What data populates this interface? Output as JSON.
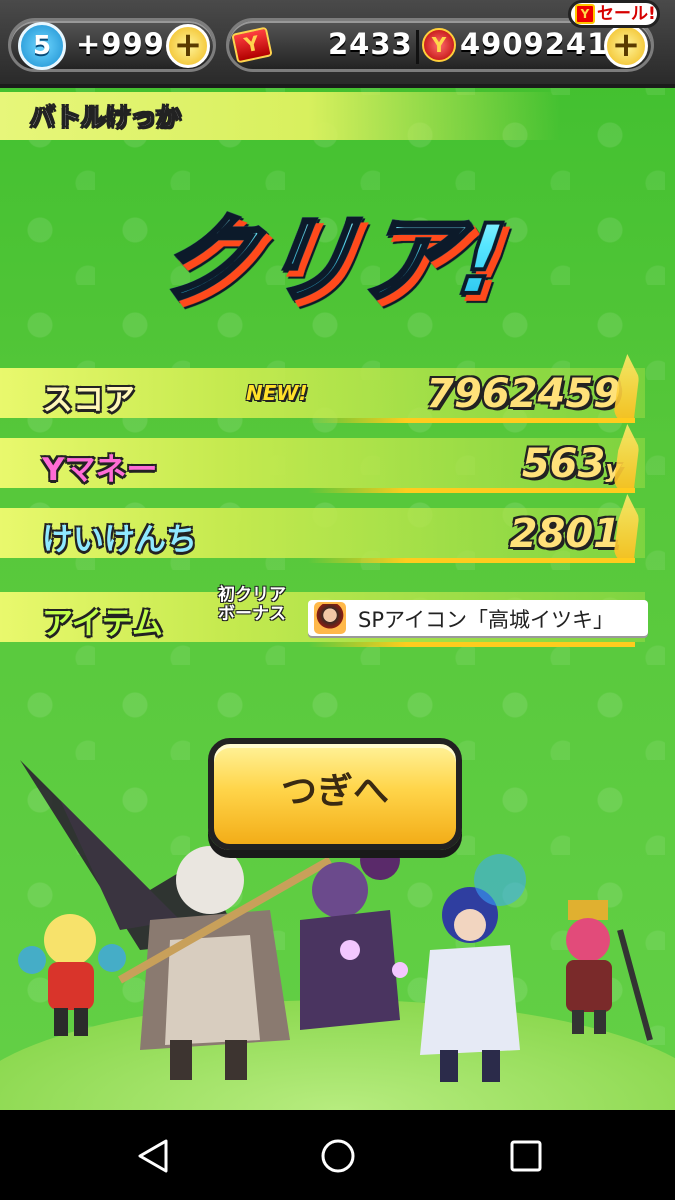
{
  "topbar": {
    "level": "5",
    "stamina": "+999",
    "tickets": "2433",
    "money": "4909241",
    "sale_label": "セール!"
  },
  "section_title": "バトルけっか",
  "clear_text": "クリア!",
  "results": {
    "score": {
      "label": "スコア",
      "badge": "NEW!",
      "value": "7962459"
    },
    "ymoney": {
      "label": "Yマネー",
      "value": "563",
      "unit": "y"
    },
    "exp": {
      "label": "けいけんち",
      "value": "2801"
    },
    "item": {
      "label": "アイテム",
      "bonus_label_line1": "初クリア",
      "bonus_label_line2": "ボーナス",
      "item_name": "SPアイコン「高城イツキ」"
    }
  },
  "next_button": "つぎへ",
  "icons": {
    "level": "level-badge-icon",
    "ticket": "ticket-icon",
    "coin": "coin-icon",
    "plus": "plus-icon",
    "back": "back-triangle-icon",
    "home": "home-circle-icon",
    "recent": "recent-square-icon"
  },
  "colors": {
    "background": "#56c73a",
    "button": "#ffd54a",
    "clear_text": "#58e6ff"
  }
}
